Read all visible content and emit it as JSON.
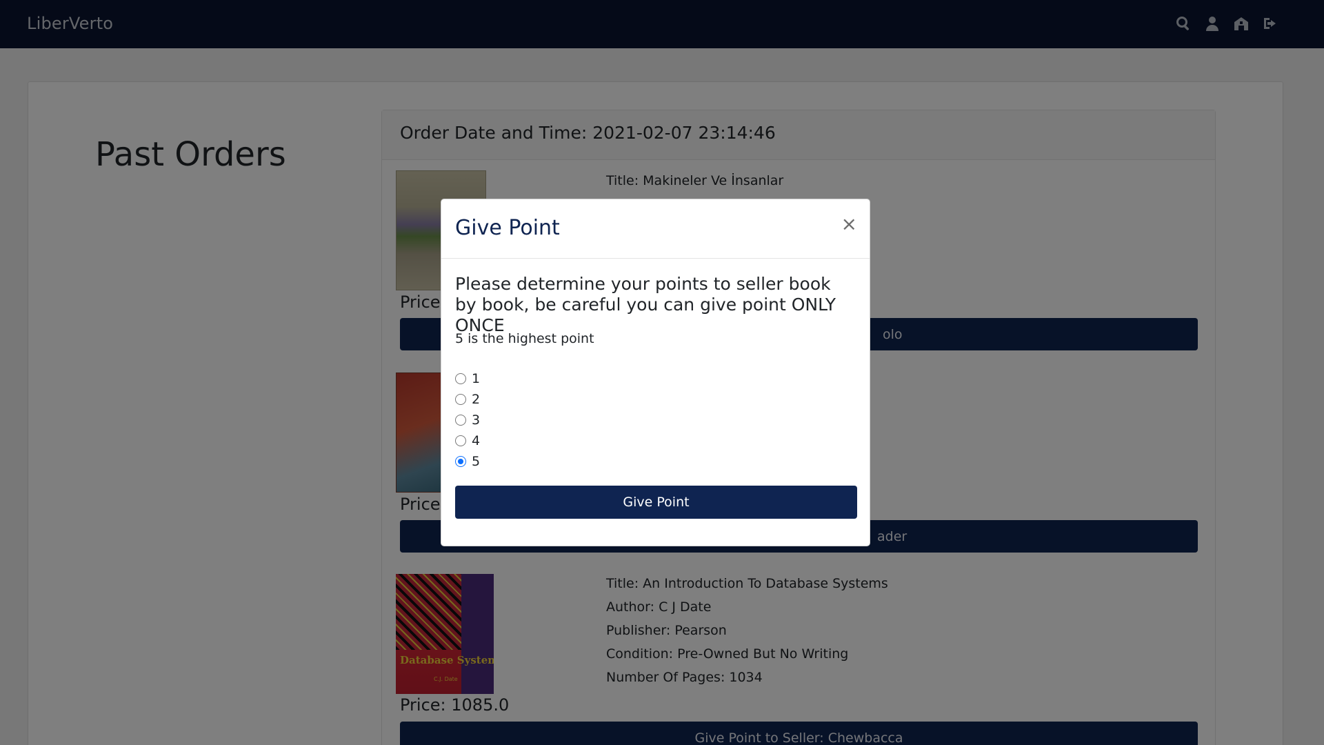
{
  "navbar": {
    "brand": "LiberVerto",
    "icons": [
      "search-icon",
      "user-icon",
      "store-icon",
      "logout-icon"
    ]
  },
  "page": {
    "title": "Past Orders"
  },
  "order": {
    "header": "Order Date and Time: 2021-02-07 23:14:46",
    "books": [
      {
        "title": "Title: Makineler Ve İnsanlar",
        "price": "Price:",
        "button_suffix": "olo"
      },
      {
        "price": "Price:",
        "button_suffix": "ader"
      },
      {
        "title": "Title: An Introduction To Database Systems",
        "author": "Author: C J Date",
        "publisher": "Publisher: Pearson",
        "condition": "Condition: Pre-Owned But No Writing",
        "pages": "Number Of Pages: 1034",
        "price": "Price: 1085.0",
        "button": "Give Point to Seller: Chewbacca",
        "cover_text": "Database Systems",
        "cover_author": "C.J. Date"
      }
    ]
  },
  "modal": {
    "title": "Give Point",
    "close": "×",
    "heading": "Please determine your points to seller book by book, be careful you can give point ONLY ONCE",
    "note": "5 is the highest point",
    "options": [
      "1",
      "2",
      "3",
      "4",
      "5"
    ],
    "selected": "5",
    "button": "Give Point"
  },
  "colors": {
    "navbar": "#0a1530",
    "primary": "#0f2451",
    "radio_checked": "#0b6efd"
  }
}
